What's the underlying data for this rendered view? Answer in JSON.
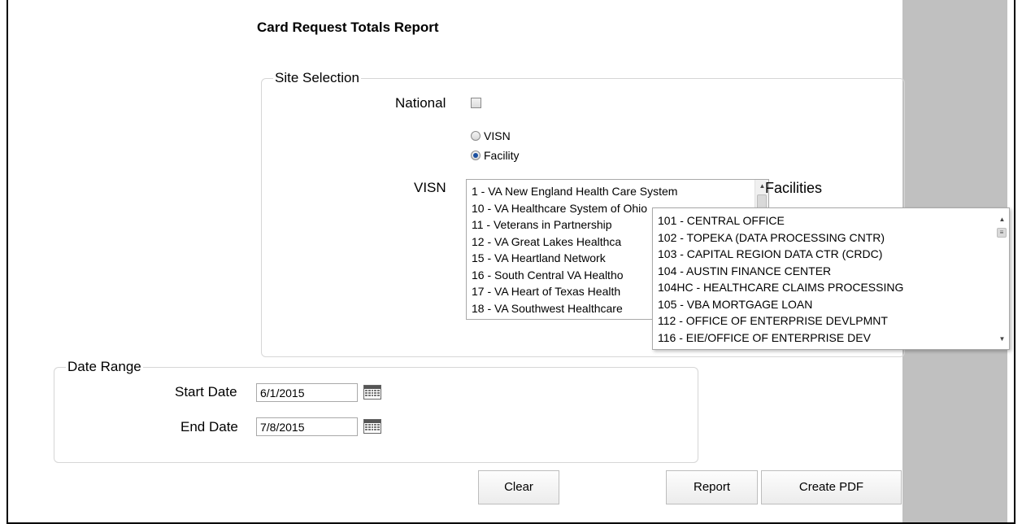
{
  "page": {
    "title": "Card Request Totals Report"
  },
  "site_selection": {
    "legend": "Site Selection",
    "national_label": "National",
    "national_checked": false,
    "radios": [
      {
        "label": "VISN",
        "selected": false
      },
      {
        "label": "Facility",
        "selected": true
      }
    ],
    "visn_label": "VISN",
    "facilities_label": "Facilities",
    "visn_options": [
      "1 - VA New England Health Care System",
      "10 - VA Healthcare System of Ohio",
      "11 - Veterans in Partnership",
      "12 - VA Great Lakes Healthca",
      "15 - VA Heartland Network",
      "16 - South Central VA Healtho",
      "17 - VA Heart of Texas Health",
      "18 - VA Southwest Healthcare"
    ],
    "facility_options": [
      "101 - CENTRAL OFFICE",
      "102 - TOPEKA (DATA PROCESSING CNTR)",
      "103 - CAPITAL REGION DATA CTR (CRDC)",
      "104 - AUSTIN FINANCE CENTER",
      "104HC - HEALTHCARE CLAIMS PROCESSING",
      "105 - VBA MORTGAGE LOAN",
      "112 - OFFICE OF ENTERPRISE DEVLPMNT",
      "116 - EIE/OFFICE OF ENTERPRISE DEV"
    ]
  },
  "date_range": {
    "legend": "Date Range",
    "start_label": "Start Date",
    "start_value": "6/1/2015",
    "end_label": "End Date",
    "end_value": "7/8/2015"
  },
  "buttons": {
    "clear": "Clear",
    "report": "Report",
    "create_pdf": "Create PDF"
  }
}
